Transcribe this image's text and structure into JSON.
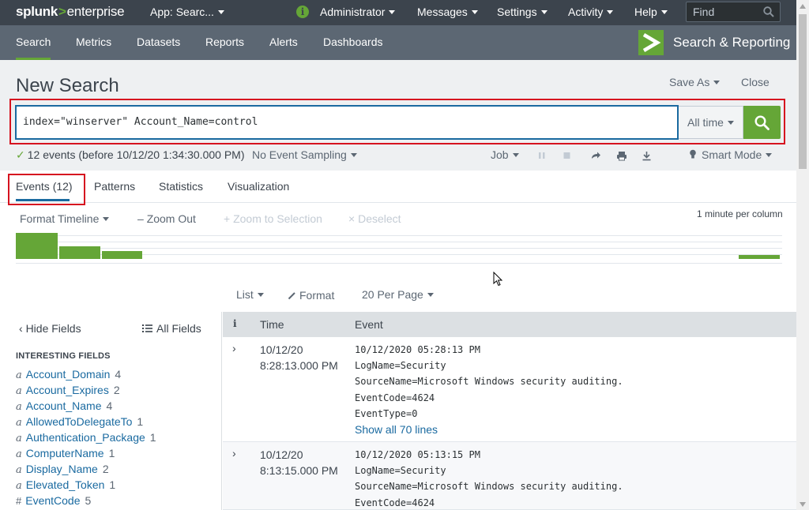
{
  "topbar": {
    "logo_brand": "splunk",
    "logo_sep": ">",
    "logo_product": "enterprise",
    "app_menu": "App: Searc...",
    "admin_menu": "Administrator",
    "messages_menu": "Messages",
    "settings_menu": "Settings",
    "activity_menu": "Activity",
    "help_menu": "Help",
    "find_placeholder": "Find",
    "info_icon": "i"
  },
  "appbar": {
    "tabs": [
      "Search",
      "Metrics",
      "Datasets",
      "Reports",
      "Alerts",
      "Dashboards"
    ],
    "app_logo_glyph": ">",
    "app_name": "Search & Reporting"
  },
  "page": {
    "title": "New Search",
    "save_as": "Save As",
    "close": "Close"
  },
  "search": {
    "query": "index=\"winserver\" Account_Name=control",
    "time_range": "All time"
  },
  "status": {
    "events_text": "12 events (before 10/12/20 1:34:30.000 PM)",
    "sampling": "No Event Sampling",
    "job": "Job",
    "mode": "Smart Mode"
  },
  "result_tabs": [
    "Events (12)",
    "Patterns",
    "Statistics",
    "Visualization"
  ],
  "timeline": {
    "format": "Format Timeline",
    "zoom_out": "Zoom Out",
    "zoom_selection": "Zoom to Selection",
    "deselect": "Deselect",
    "scale": "1 minute per column",
    "bar_levels": [
      1.0,
      0.47,
      0.31,
      0.16
    ]
  },
  "list_controls": {
    "list": "List",
    "format": "Format",
    "per_page": "20 Per Page"
  },
  "fields": {
    "hide": "Hide Fields",
    "all": "All Fields",
    "section": "INTERESTING FIELDS",
    "items": [
      {
        "type": "a",
        "name": "Account_Domain",
        "count": "4"
      },
      {
        "type": "a",
        "name": "Account_Expires",
        "count": "2"
      },
      {
        "type": "a",
        "name": "Account_Name",
        "count": "4"
      },
      {
        "type": "a",
        "name": "AllowedToDelegateTo",
        "count": "1"
      },
      {
        "type": "a",
        "name": "Authentication_Package",
        "count": "1"
      },
      {
        "type": "a",
        "name": "ComputerName",
        "count": "1"
      },
      {
        "type": "a",
        "name": "Display_Name",
        "count": "2"
      },
      {
        "type": "a",
        "name": "Elevated_Token",
        "count": "1"
      },
      {
        "type": "#",
        "name": "EventCode",
        "count": "5"
      }
    ]
  },
  "events_table": {
    "col_info": "i",
    "col_time": "Time",
    "col_event": "Event",
    "rows": [
      {
        "date": "10/12/20",
        "time": "8:28:13.000 PM",
        "lines": [
          "10/12/2020 05:28:13 PM",
          "LogName=Security",
          "SourceName=Microsoft Windows security auditing.",
          "EventCode=4624",
          "EventType=0"
        ],
        "show_all": "Show all 70 lines"
      },
      {
        "date": "10/12/20",
        "time": "8:13:15.000 PM",
        "lines": [
          "10/12/2020 05:13:15 PM",
          "LogName=Security",
          "SourceName=Microsoft Windows security auditing.",
          "EventCode=4624"
        ],
        "show_all": ""
      }
    ]
  },
  "colors": {
    "accent_green": "#65a637",
    "link_blue": "#1a6aa0",
    "highlight_red": "#d6131f",
    "topbar_bg": "#3c444d",
    "appbar_bg": "#5c6773"
  }
}
